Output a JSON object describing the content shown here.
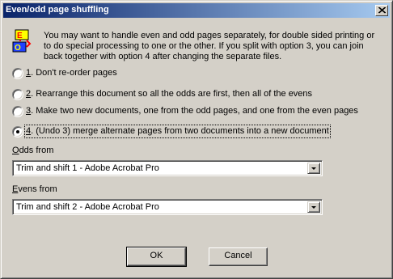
{
  "dialog": {
    "title": "Even/odd page shuffling",
    "intro": "You may want to handle even and odd pages separately, for double sided printing or to do special processing to one or the other. If you split with option 3, you can join back together with option 4 after changing the separate files."
  },
  "options": [
    {
      "mnemonic": "1",
      "text": ". Don't re-order pages",
      "selected": false
    },
    {
      "mnemonic": "2",
      "text": ". Rearrange this document so all the odds are first, then all of the evens",
      "selected": false
    },
    {
      "mnemonic": "3",
      "text": ". Make two new documents, one from the odd pages, and one from the even pages",
      "selected": false
    },
    {
      "mnemonic": "4",
      "text": ". (Undo 3) merge alternate pages from two documents into a new document",
      "selected": true
    }
  ],
  "odds": {
    "label_mnemonic": "O",
    "label_rest": "dds from",
    "value": "Trim and shift 1 - Adobe Acrobat Pro"
  },
  "evens": {
    "label_mnemonic": "E",
    "label_rest": "vens from",
    "value": "Trim and shift 2 - Adobe Acrobat Pro"
  },
  "buttons": {
    "ok": "OK",
    "cancel": "Cancel"
  },
  "icons": {
    "close": "close-icon",
    "app": "odd-even-pages-icon",
    "dropdown": "chevron-down-icon"
  }
}
